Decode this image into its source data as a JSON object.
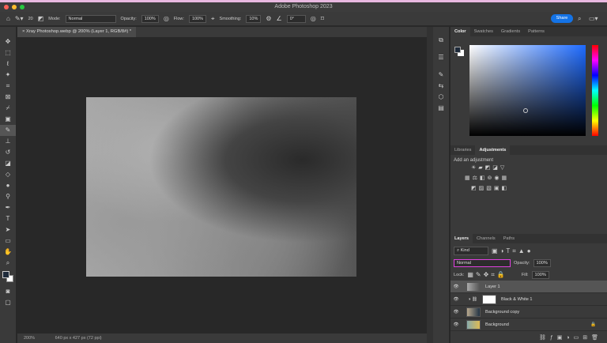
{
  "window": {
    "title": "Adobe Photoshop 2023"
  },
  "options": {
    "mode_label": "Mode:",
    "mode": "Normal",
    "opacity_label": "Opacity:",
    "opacity": "100%",
    "flow_label": "Flow:",
    "flow": "100%",
    "smoothing_label": "Smoothing:",
    "smoothing": "10%",
    "angle": "0°",
    "brush_size": "20",
    "share": "Share"
  },
  "document": {
    "tab": "Xray Photoshop.webp @ 200% (Layer 1, RGB/8#) *",
    "zoom": "200%",
    "info": "640 px x 427 px (72 ppi)"
  },
  "color_panel": {
    "tabs": [
      "Color",
      "Swatches",
      "Gradients",
      "Patterns"
    ],
    "foreground": "#1e2a3a",
    "background": "#ffffff"
  },
  "adjust_panel": {
    "tabs": [
      "Libraries",
      "Adjustments"
    ],
    "hint": "Add an adjustment"
  },
  "layers_panel": {
    "tabs": [
      "Layers",
      "Channels",
      "Paths"
    ],
    "filter": "Kind",
    "blend_mode": "Normal",
    "opacity_label": "Opacity:",
    "opacity": "100%",
    "lock_label": "Lock:",
    "fill_label": "Fill:",
    "fill": "100%",
    "layers": [
      {
        "name": "Layer 1"
      },
      {
        "name": "Black & White 1"
      },
      {
        "name": "Background copy"
      },
      {
        "name": "Background"
      }
    ]
  },
  "colors": {
    "accent": "#1473e6",
    "highlight": "#e040e0"
  }
}
